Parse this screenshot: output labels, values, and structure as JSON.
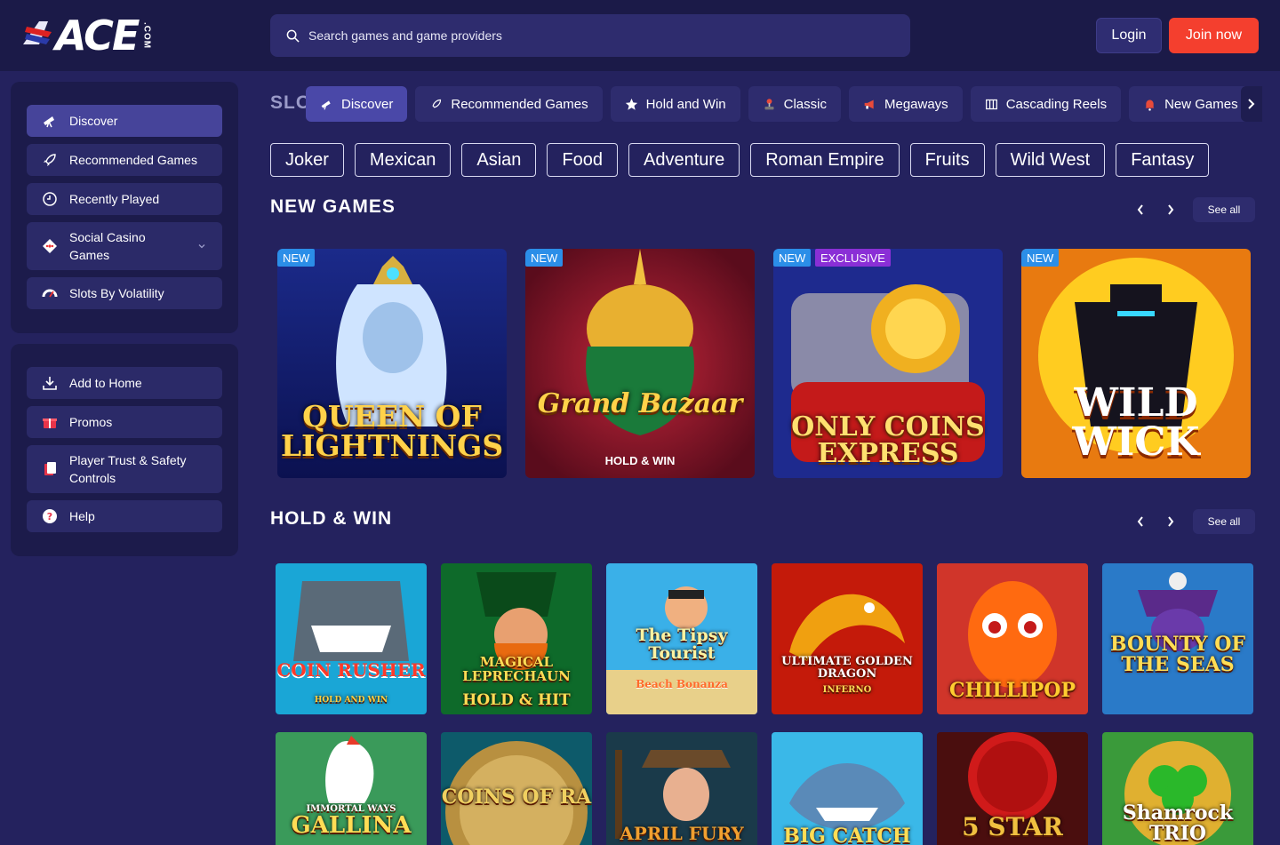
{
  "header": {
    "logo_text": "ACE",
    "logo_suffix": ".COM",
    "search_placeholder": "Search games and game providers",
    "login_label": "Login",
    "join_label": "Join now"
  },
  "sidebar": {
    "primary": [
      {
        "label": "Discover",
        "icon": "telescope-icon",
        "active": true
      },
      {
        "label": "Recommended Games",
        "icon": "rocket-icon"
      },
      {
        "label": "Recently Played",
        "icon": "clock-icon"
      },
      {
        "label": "Social Casino Games",
        "icon": "dice-icon",
        "expandable": true
      },
      {
        "label": "Slots By Volatility",
        "icon": "gauge-icon"
      }
    ],
    "secondary": [
      {
        "label": "Add to Home",
        "icon": "download-icon"
      },
      {
        "label": "Promos",
        "icon": "gift-icon"
      },
      {
        "label": "Player Trust & Safety Controls",
        "icon": "document-icon"
      },
      {
        "label": "Help",
        "icon": "help-icon"
      }
    ]
  },
  "category_tabs": {
    "hidden_heading_fragment": "SLO",
    "items": [
      {
        "label": "Discover",
        "icon": "telescope-icon",
        "active": true
      },
      {
        "label": "Recommended Games",
        "icon": "rocket-icon"
      },
      {
        "label": "Hold and Win",
        "icon": "star-icon"
      },
      {
        "label": "Classic",
        "icon": "joystick-icon"
      },
      {
        "label": "Megaways",
        "icon": "megaphone-icon"
      },
      {
        "label": "Cascading Reels",
        "icon": "columns-icon"
      },
      {
        "label": "New Games",
        "icon": "bell-icon"
      }
    ]
  },
  "theme_chips": [
    "Joker",
    "Mexican",
    "Asian",
    "Food",
    "Adventure",
    "Roman Empire",
    "Fruits",
    "Wild West",
    "Fantasy"
  ],
  "new_games": {
    "title": "NEW GAMES",
    "see_all": "See all",
    "games": [
      {
        "name": "QUEEN OF LIGHTNINGS",
        "badges": [
          "NEW"
        ]
      },
      {
        "name": "Grand Bazaar",
        "subtitle": "HOLD & WIN",
        "badges": [
          "NEW"
        ]
      },
      {
        "name": "ONLY COINS EXPRESS",
        "badges": [
          "NEW",
          "EXCLUSIVE"
        ]
      },
      {
        "name": "WILD WICK",
        "badges": [
          "NEW"
        ]
      }
    ]
  },
  "hold_win": {
    "title": "HOLD & WIN",
    "see_all": "See all",
    "row1": [
      {
        "name": "COIN RUSHER",
        "subtitle": "HOLD AND WIN"
      },
      {
        "name": "MAGICAL LEPRECHAUN",
        "subtitle": "HOLD & HIT"
      },
      {
        "name": "The Tipsy Tourist",
        "subtitle": "Beach Bonanza"
      },
      {
        "name": "ULTIMATE GOLDEN DRAGON",
        "subtitle": "INFERNO"
      },
      {
        "name": "CHILLIPOP",
        "subtitle": ""
      },
      {
        "name": "BOUNTY OF THE SEAS",
        "subtitle": ""
      }
    ],
    "row2": [
      {
        "name": "GALLINA",
        "subtitle": "IMMORTAL WAYS"
      },
      {
        "name": "COINS OF RA",
        "subtitle": ""
      },
      {
        "name": "APRIL FURY",
        "subtitle": ""
      },
      {
        "name": "BIG CATCH",
        "subtitle": ""
      },
      {
        "name": "5 STAR",
        "subtitle": ""
      },
      {
        "name": "Shamrock TRIO",
        "subtitle": ""
      }
    ]
  },
  "colors": {
    "background": "#24225e",
    "topbar": "#1b1a48",
    "accent": "#f43f2e",
    "new_badge": "#2b8ee8",
    "exclusive_badge": "#8a2fd6"
  }
}
